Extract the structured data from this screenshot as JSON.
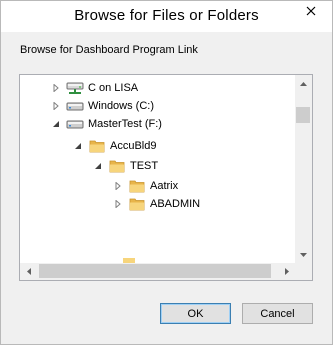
{
  "window": {
    "title": "Browse for Files or Folders",
    "prompt": "Browse for Dashboard Program Link"
  },
  "tree": {
    "nodes": [
      {
        "label": "C on LISA",
        "icon": "network-drive-icon",
        "expander": "collapsed"
      },
      {
        "label": "Windows (C:)",
        "icon": "hard-drive-icon",
        "expander": "collapsed"
      },
      {
        "label": "MasterTest (F:)",
        "icon": "hard-drive-icon",
        "expander": "expanded"
      },
      {
        "label": "AccuBld9",
        "icon": "folder-icon",
        "expander": "expanded"
      },
      {
        "label": "TEST",
        "icon": "folder-icon",
        "expander": "expanded"
      },
      {
        "label": "Aatrix",
        "icon": "folder-icon",
        "expander": "collapsed"
      },
      {
        "label": "ABADMIN",
        "icon": "folder-icon",
        "expander": "collapsed"
      }
    ]
  },
  "buttons": {
    "ok": "OK",
    "cancel": "Cancel"
  }
}
